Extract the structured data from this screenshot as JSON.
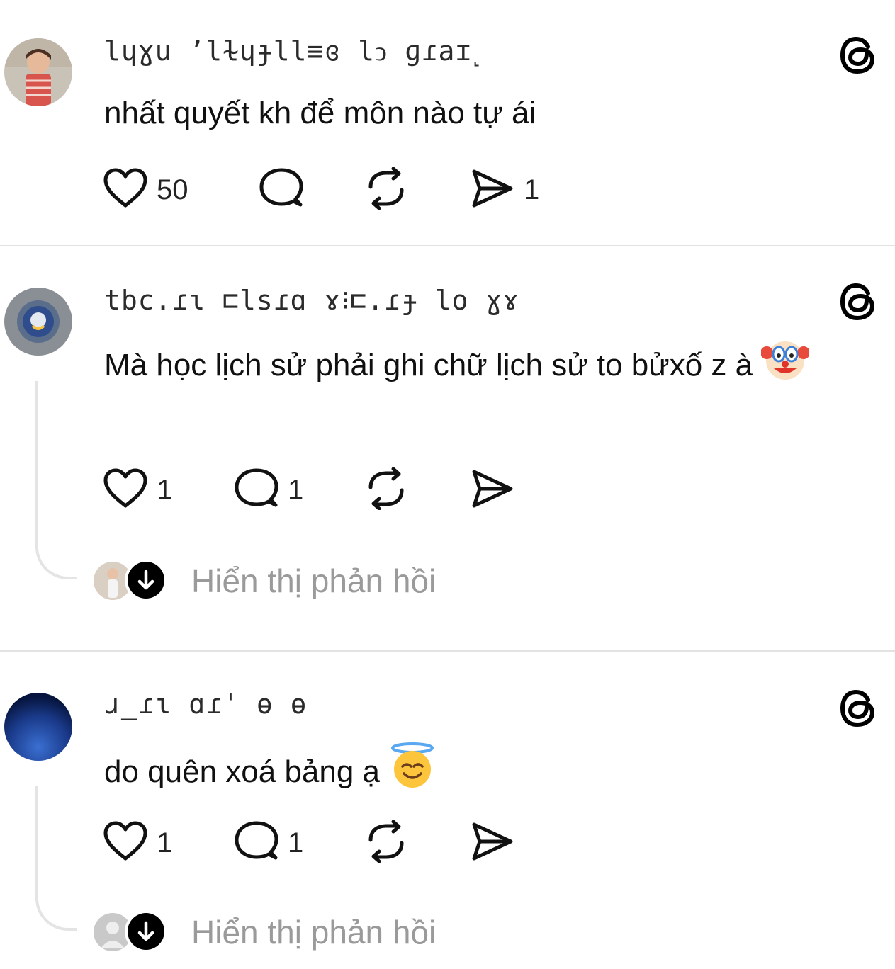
{
  "posts": [
    {
      "username": "lɥɣu ʼlɫɥɟll≡ɞ lↄ ɡɾaɪ˻",
      "text": "nhất quyết kh để môn nào tự ái",
      "emoji": "",
      "likes": "50",
      "replies": "",
      "reposts": "",
      "shares": "1"
    },
    {
      "username": "tbc.ɾɩ ⊏lsɾɑ ɤ⁝⊏.ɾɟ lo ɣɤ",
      "text": "Mà học lịch sử phải ghi chữ lịch sử to bửxố z à",
      "emoji": "clown-face",
      "likes": "1",
      "replies": "1",
      "reposts": "",
      "shares": "",
      "show_replies": "Hiển thị phản hồi"
    },
    {
      "username": "ɹ_ɾɩ   ɑɾˈ   ɵ ɵ",
      "text": "do quên xoá bảng ạ",
      "emoji": "smiling-face-with-halo",
      "likes": "1",
      "replies": "1",
      "reposts": "",
      "shares": "",
      "show_replies": "Hiển thị phản hồi"
    }
  ]
}
